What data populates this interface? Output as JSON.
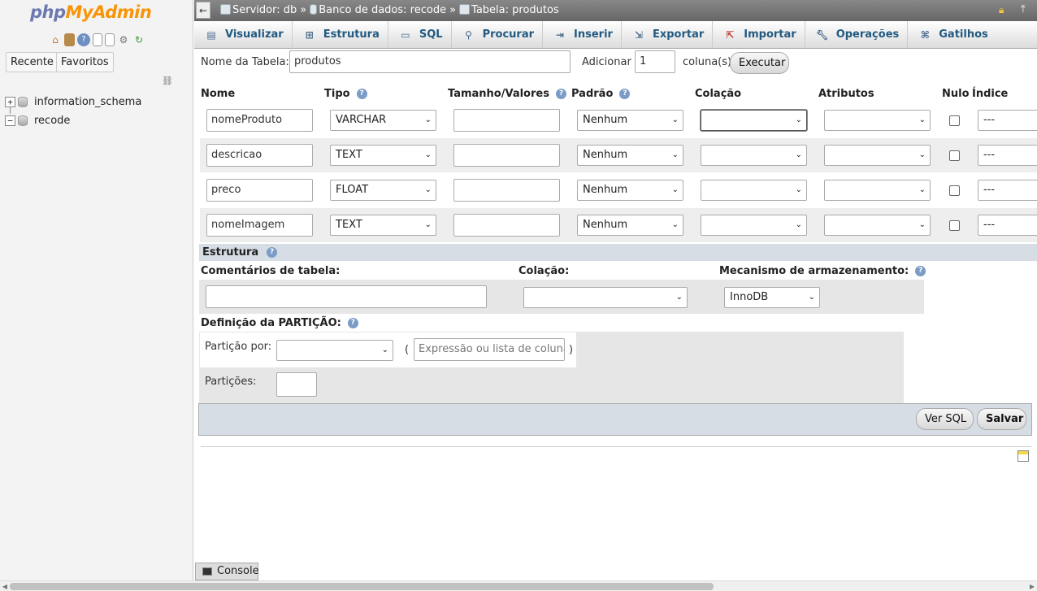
{
  "sidebar": {
    "logo_php": "php",
    "logo_myadmin": "MyAdmin",
    "quick_icons": [
      "home-icon",
      "exit-icon",
      "help-icon",
      "docs-icon",
      "docs2-icon",
      "settings-icon",
      "reload-icon"
    ],
    "recent_label": "Recente",
    "favorites_label": "Favoritos",
    "tree": [
      {
        "name": "information_schema",
        "expander": "+"
      },
      {
        "name": "recode",
        "expander": "−"
      }
    ]
  },
  "topbar": {
    "back_label": "←",
    "server": "Servidor: db",
    "database": "Banco de dados: recode",
    "table": "Tabela: produtos",
    "sep": "»"
  },
  "tabs": [
    {
      "label": "Visualizar",
      "icon": "browse-icon"
    },
    {
      "label": "Estrutura",
      "icon": "structure-icon"
    },
    {
      "label": "SQL",
      "icon": "sql-icon"
    },
    {
      "label": "Procurar",
      "icon": "search-icon"
    },
    {
      "label": "Inserir",
      "icon": "insert-icon"
    },
    {
      "label": "Exportar",
      "icon": "export-icon"
    },
    {
      "label": "Importar",
      "icon": "import-icon"
    },
    {
      "label": "Operações",
      "icon": "wrench-icon"
    },
    {
      "label": "Gatilhos",
      "icon": "triggers-icon"
    }
  ],
  "form": {
    "table_name_label": "Nome da Tabela:",
    "table_name_value": "produtos",
    "add_label": "Adicionar",
    "add_value": "1",
    "columns_label": "coluna(s)",
    "execute_label": "Executar"
  },
  "headers": {
    "name": "Nome",
    "type": "Tipo",
    "length": "Tamanho/Valores",
    "default": "Padrão",
    "collation": "Colação",
    "attributes": "Atributos",
    "null": "Nulo",
    "index": "Índice"
  },
  "columns": [
    {
      "name": "nomeProduto",
      "type": "VARCHAR",
      "length": "",
      "default": "Nenhum",
      "collation": "",
      "attributes": "",
      "null": false,
      "index": "---"
    },
    {
      "name": "descricao",
      "type": "TEXT",
      "length": "",
      "default": "Nenhum",
      "collation": "",
      "attributes": "",
      "null": false,
      "index": "---"
    },
    {
      "name": "preco",
      "type": "FLOAT",
      "length": "",
      "default": "Nenhum",
      "collation": "",
      "attributes": "",
      "null": false,
      "index": "---"
    },
    {
      "name": "nomeImagem",
      "type": "TEXT",
      "length": "",
      "default": "Nenhum",
      "collation": "",
      "attributes": "",
      "null": false,
      "index": "---"
    }
  ],
  "structure": {
    "title": "Estrutura",
    "comments_label": "Comentários de tabela:",
    "comments_value": "",
    "collation_label": "Colação:",
    "collation_value": "",
    "engine_label": "Mecanismo de armazenamento:",
    "engine_value": "InnoDB"
  },
  "partition": {
    "title": "Definição da PARTIÇÃO:",
    "by_label": "Partição por:",
    "by_value": "",
    "paren_open": "(",
    "paren_close": ")",
    "expression_placeholder": "Expressão ou lista de colunas",
    "count_label": "Partições:",
    "count_value": ""
  },
  "actions": {
    "preview_sql": "Ver SQL",
    "save": "Salvar"
  },
  "console_label": "Console",
  "help_glyph": "?",
  "chevron_glyph": "⌄"
}
